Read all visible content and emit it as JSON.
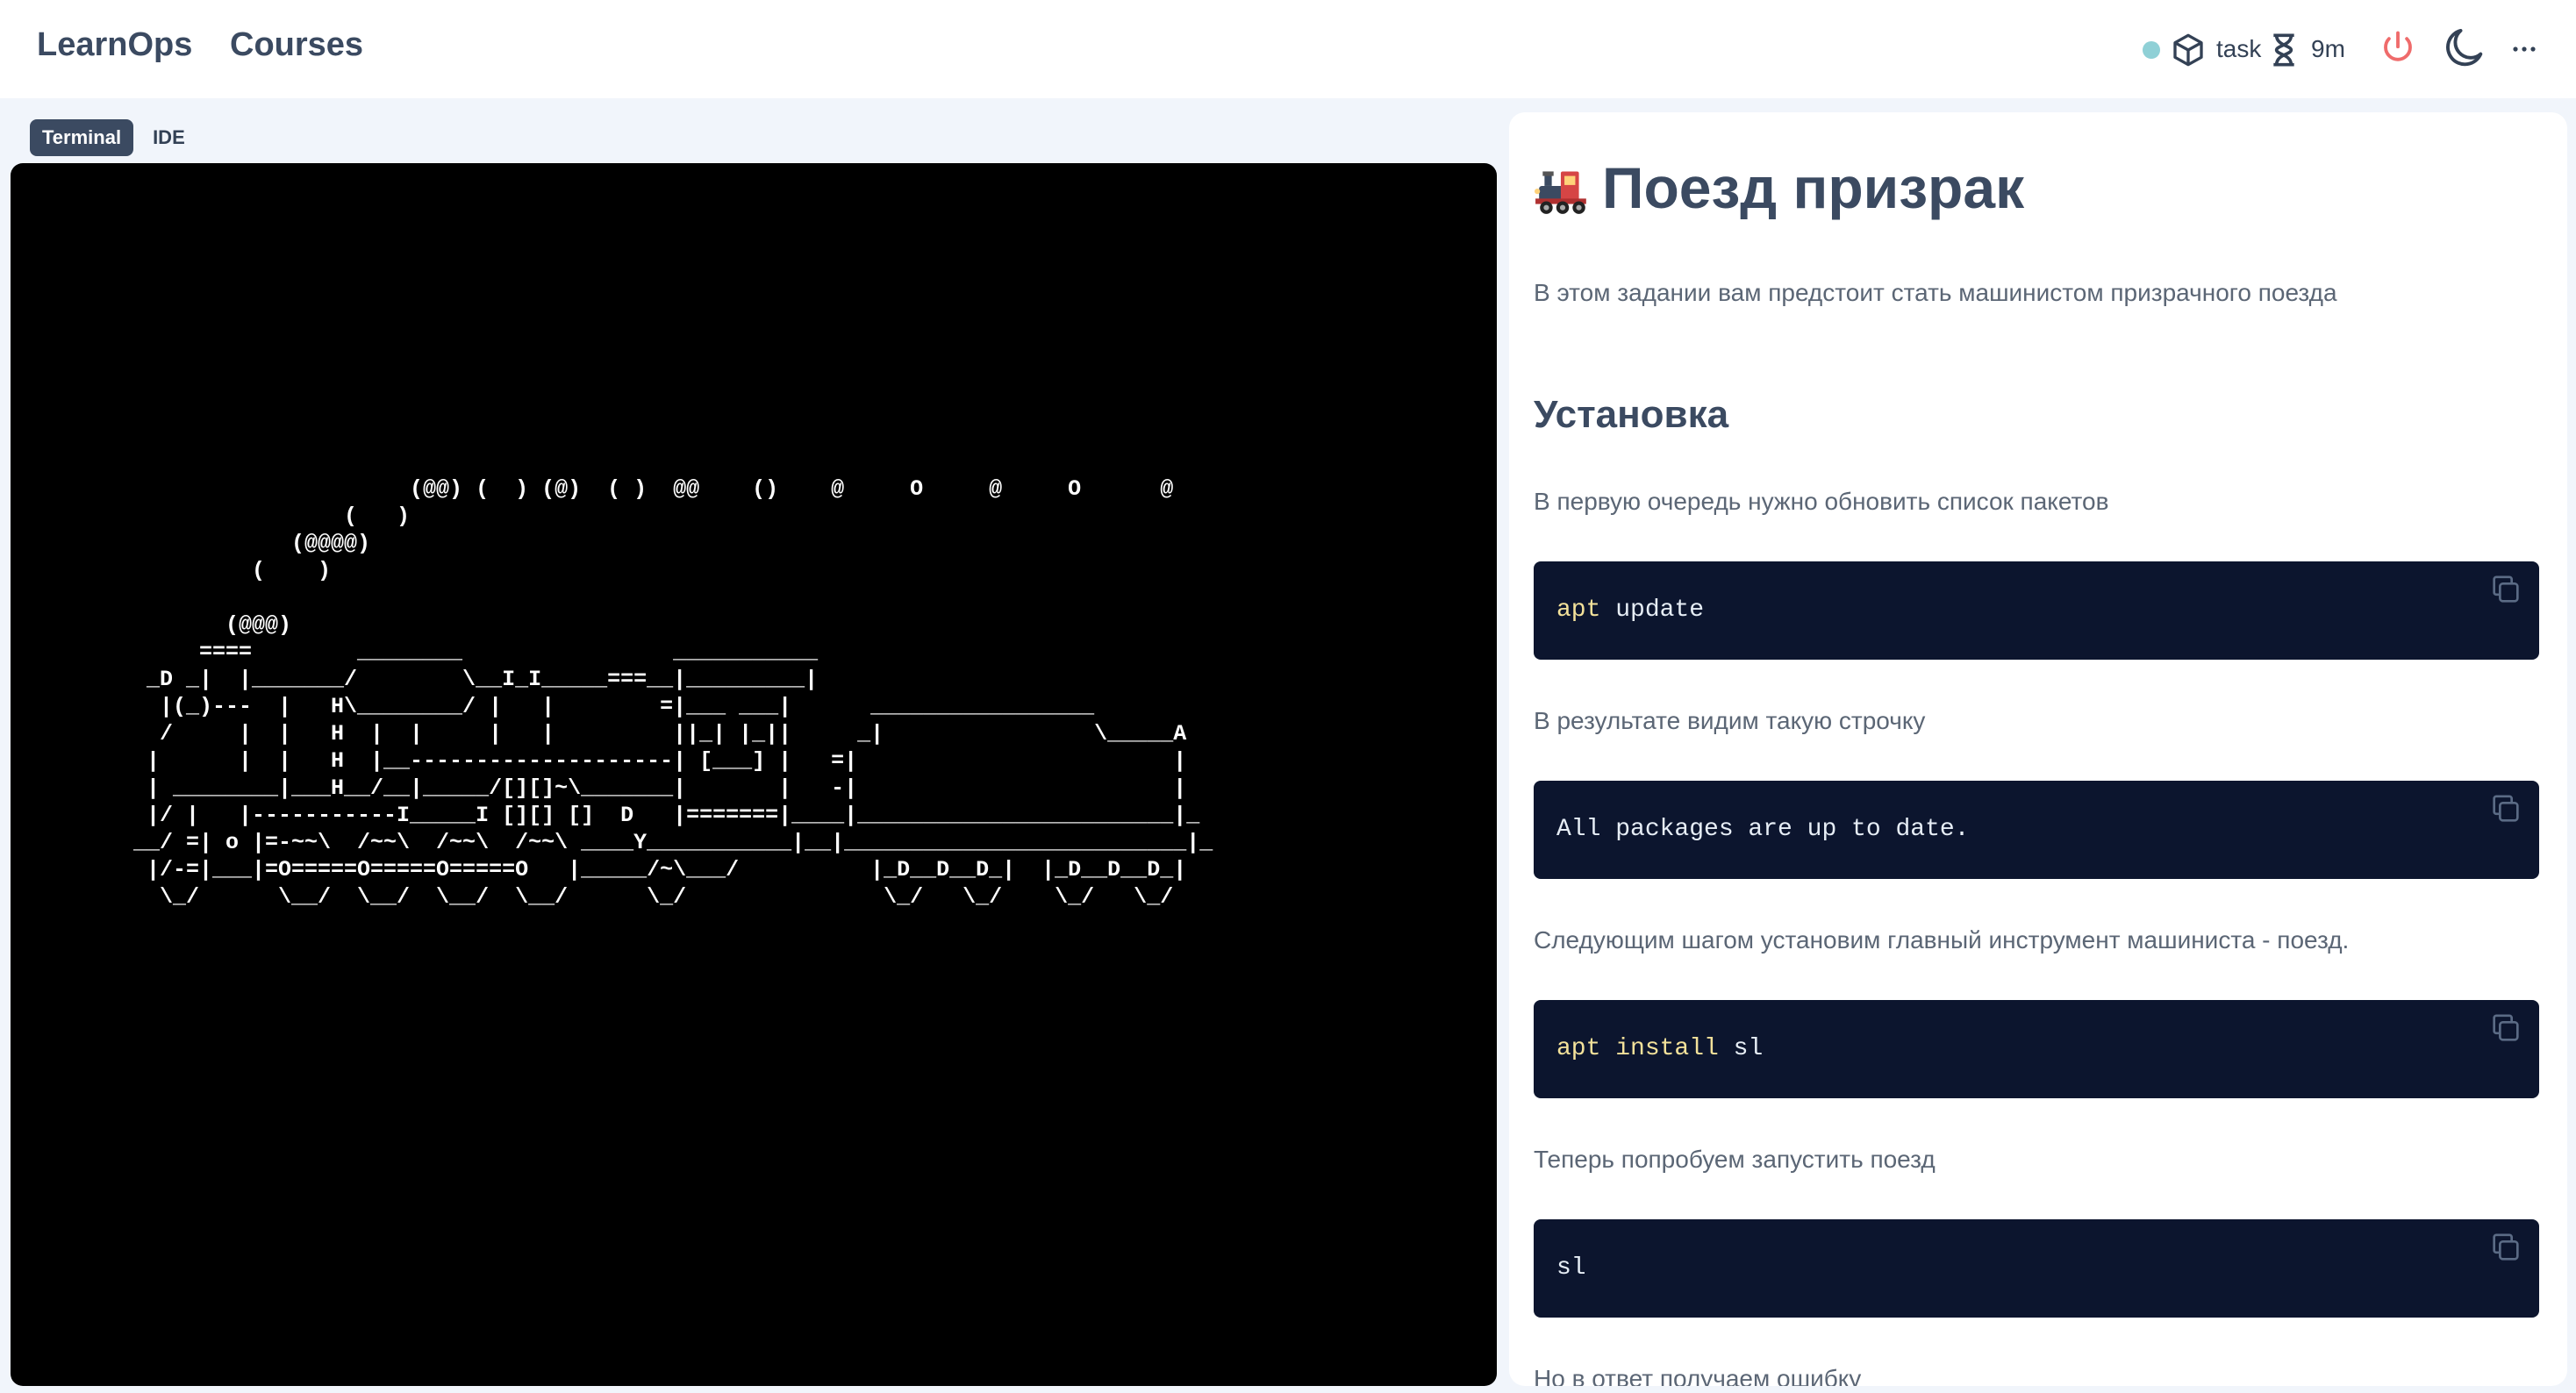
{
  "header": {
    "brand": "LearnOps",
    "nav_courses": "Courses",
    "task_label": "task",
    "time_label": "9m",
    "icons": [
      "status-dot",
      "cube-icon",
      "hourglass-icon",
      "power-icon",
      "moon-icon",
      "more-icon"
    ],
    "colors": {
      "status_dot": "#8fd0d6",
      "power": "#ef6b6b"
    }
  },
  "tabs": [
    {
      "label": "Terminal",
      "active": true
    },
    {
      "label": "IDE",
      "active": false
    }
  ],
  "terminal": {
    "ascii_art": "                     (@@) (  ) (@)  ( )  @@    ()    @     O     @     O      @\n                (   )\n            (@@@@)\n         (    )\n\n       (@@@)\n     ====        ________                ___________\n _D _|  |_______/        \\__I_I_____===__|_________|\n  |(_)---  |   H\\________/ |   |        =|___ ___|      _________________\n  /     |  |   H  |  |     |   |         ||_| |_||     _|                \\_____A\n |      |  |   H  |__--------------------| [___] |   =|                        |\n | ________|___H__/__|_____/[][]~\\_______|       |   -|                        |\n |/ |   |-----------I_____I [][] []  D   |=======|____|________________________|_\n__/ =| o |=-~~\\  /~~\\  /~~\\  /~~\\ ____Y___________|__|__________________________|_\n |/-=|___|=O=====O=====O=====O   |_____/~\\___/          |_D__D__D_|  |_D__D__D_|\n  \\_/      \\__/  \\__/  \\__/  \\__/      \\_/               \\_/   \\_/    \\_/   \\_/"
  },
  "lesson": {
    "title": "Поезд призрак",
    "intro": "В этом задании вам предстоит стать машинистом призрачного поезда",
    "section_title": "Установка",
    "p1": "В первую очередь нужно обновить список пакетов",
    "code1_cmd": "apt",
    "code1_rest": " update",
    "p2": "В результате видим такую строчку",
    "code2": "All packages are up to date.",
    "p3": "Следующим шагом установим главный инструмент машиниста - поезд.",
    "code3_cmd": "apt install",
    "code3_rest": " sl",
    "p4": "Теперь попробуем запустить поезд",
    "code4": "sl",
    "p5": "Но в ответ получаем ошибку"
  }
}
